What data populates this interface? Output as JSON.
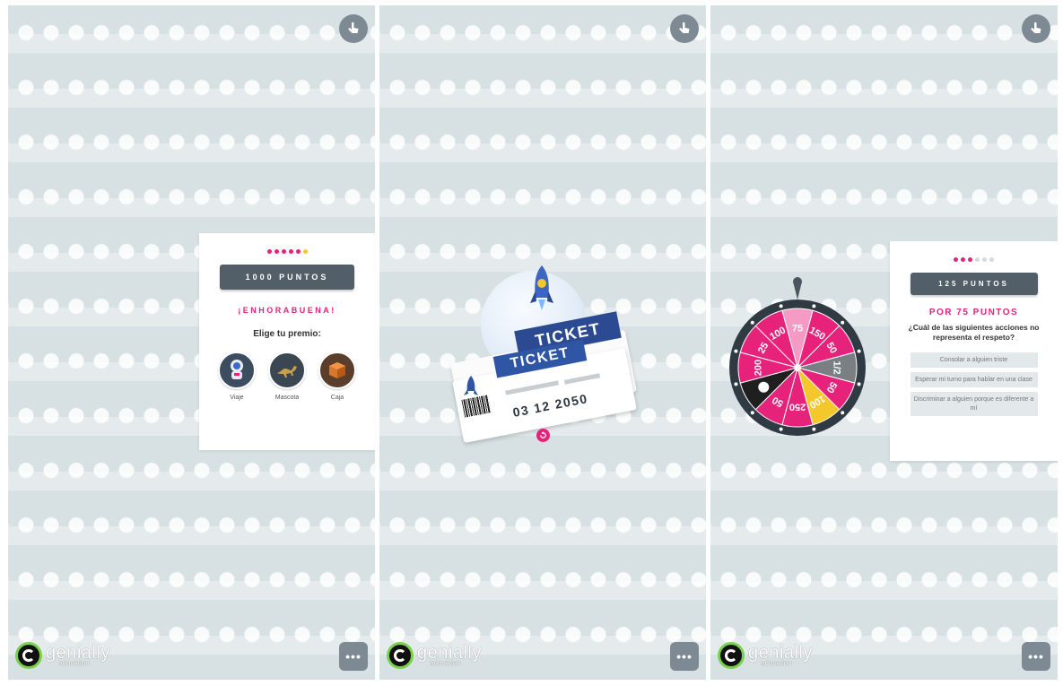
{
  "colors": {
    "background": "#d7e1e3",
    "accent_pink": "#e6227a",
    "dark_bar": "#525f68",
    "ticket_blue": "#2b4a92",
    "button_grey": "#7d8a93"
  },
  "common": {
    "logo_name": "genially",
    "logo_sub": "education",
    "more_label": "•••",
    "lock_icon": "pointer-hand-icon"
  },
  "panel1": {
    "score": "1000 PUNTOS",
    "heading": "¡ENHORABUENA!",
    "prompt": "Elige tu premio:",
    "prizes": [
      {
        "label": "Viaje",
        "icon": "astronaut-icon"
      },
      {
        "label": "Mascota",
        "icon": "dinosaur-icon"
      },
      {
        "label": "Caja",
        "icon": "box-icon"
      }
    ]
  },
  "panel2": {
    "ticket_label": "TICKET",
    "ticket_label_back": "TICKET",
    "date": "03 12 2050",
    "back_digit": "0"
  },
  "panel3": {
    "score": "125 PUNTOS",
    "heading": "POR 75 PUNTOS",
    "question": "¿Cuál de las siguientes acciones no representa el respeto?",
    "answers": [
      "Consolar a alguien triste",
      "Esperar mi turno para hablar en una clase",
      "Discriminar a alguien porque es diferente a mí"
    ],
    "wheel_values": [
      "75",
      "150",
      "50",
      "1/2",
      "50",
      "100",
      "250",
      "50",
      "skull",
      "200",
      "25",
      "100"
    ]
  }
}
